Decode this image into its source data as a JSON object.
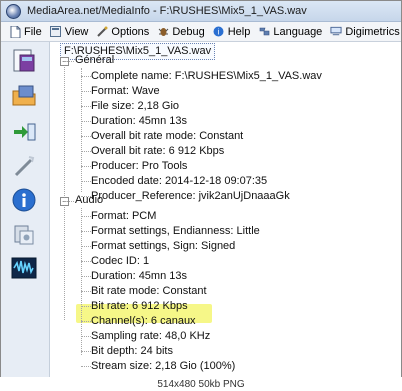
{
  "window": {
    "title": "MediaArea.net/MediaInfo - F:\\RUSHES\\Mix5_1_VAS.wav",
    "colors": {
      "titlebar": "#c6d6ea",
      "highlight": "#f4f56a"
    }
  },
  "menu": {
    "items": [
      {
        "label": "File",
        "icon": "document-icon"
      },
      {
        "label": "View",
        "icon": "view-icon"
      },
      {
        "label": "Options",
        "icon": "options-icon"
      },
      {
        "label": "Debug",
        "icon": "debug-icon"
      },
      {
        "label": "Help",
        "icon": "help-icon"
      },
      {
        "label": "Language",
        "icon": "language-icon"
      },
      {
        "label": "Digimetrics website",
        "icon": "website-icon"
      }
    ]
  },
  "sidebar": {
    "buttons": [
      {
        "name": "open-file-icon"
      },
      {
        "name": "open-folder-icon"
      },
      {
        "name": "export-icon"
      },
      {
        "name": "magic-wand-icon"
      },
      {
        "name": "info-icon"
      },
      {
        "name": "settings-icon"
      },
      {
        "name": "waveform-icon"
      }
    ]
  },
  "tree": {
    "file": "F:\\RUSHES\\Mix5_1_VAS.wav",
    "general": {
      "label": "Général",
      "fields": [
        "Complete name: F:\\RUSHES\\Mix5_1_VAS.wav",
        "Format: Wave",
        "File size: 2,18 Gio",
        "Duration: 45mn 13s",
        "Overall bit rate mode: Constant",
        "Overall bit rate: 6 912 Kbps",
        "Producer: Pro Tools",
        "Encoded date: 2014-12-18 09:07:35",
        "Producer_Reference: jvik2anUjDnaaaGk"
      ]
    },
    "audio": {
      "label": "Audio",
      "fields": [
        "Format: PCM",
        "Format settings, Endianness: Little",
        "Format settings, Sign: Signed",
        "Codec ID: 1",
        "Duration: 45mn 13s",
        "Bit rate mode: Constant",
        "Bit rate: 6 912 Kbps",
        "Channel(s): 6 canaux",
        "Sampling rate: 48,0 KHz",
        "Bit depth: 24 bits",
        "Stream size: 2,18 Gio (100%)"
      ]
    }
  },
  "footer": "514x480  50kb  PNG"
}
